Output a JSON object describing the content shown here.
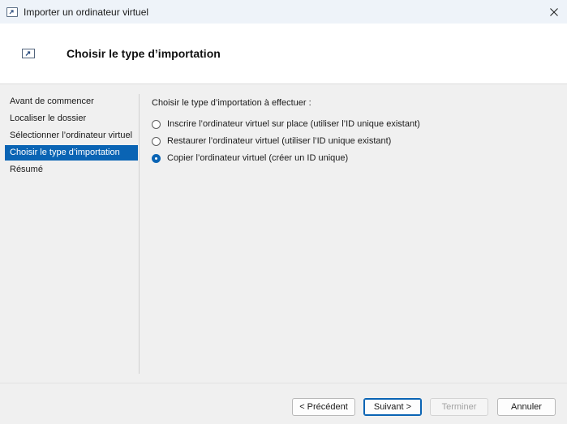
{
  "window": {
    "title": "Importer un ordinateur virtuel",
    "icon": "vm-import-icon"
  },
  "header": {
    "title": "Choisir le type d’importation",
    "icon": "vm-import-icon"
  },
  "nav": {
    "items": [
      {
        "label": "Avant de commencer",
        "selected": false
      },
      {
        "label": "Localiser le dossier",
        "selected": false
      },
      {
        "label": "Sélectionner l’ordinateur virtuel",
        "selected": false
      },
      {
        "label": "Choisir le type d’importation",
        "selected": true
      },
      {
        "label": "Résumé",
        "selected": false
      }
    ]
  },
  "main": {
    "prompt": "Choisir le type d’importation à effectuer :",
    "options": [
      {
        "label": "Inscrire l’ordinateur virtuel sur place (utiliser l’ID unique existant)",
        "checked": false
      },
      {
        "label": "Restaurer l’ordinateur virtuel (utiliser l’ID unique existant)",
        "checked": false
      },
      {
        "label": "Copier l’ordinateur virtuel (créer un ID unique)",
        "checked": true
      }
    ]
  },
  "footer": {
    "previous_label": "< Précédent",
    "next_label": "Suivant >",
    "finish_label": "Terminer",
    "cancel_label": "Annuler"
  },
  "colors": {
    "accent": "#0a64b4",
    "titlebar": "#eef3f9",
    "header_bg": "#ffffff",
    "body_bg": "#f0f0f0"
  }
}
